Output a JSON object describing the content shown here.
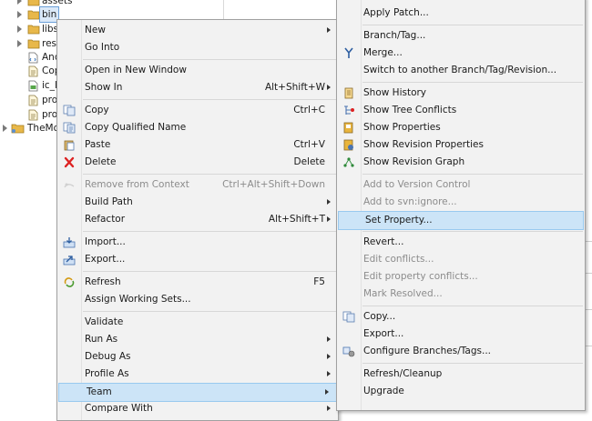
{
  "tree": {
    "items": [
      {
        "label": "assets",
        "icon": "folder-icon",
        "arrow": true
      },
      {
        "label": "bin",
        "icon": "folder-icon",
        "arrow": true,
        "selected": true
      },
      {
        "label": "libs",
        "icon": "folder-icon",
        "arrow": true
      },
      {
        "label": "res",
        "icon": "folder-icon",
        "arrow": true
      },
      {
        "label": "And",
        "icon": "xml-file-icon",
        "arrow": false
      },
      {
        "label": "Cop",
        "icon": "text-file-icon",
        "arrow": false
      },
      {
        "label": "ic_l",
        "icon": "image-file-icon",
        "arrow": false
      },
      {
        "label": "pro",
        "icon": "text-file-icon",
        "arrow": false
      },
      {
        "label": "pro",
        "icon": "text-file-icon",
        "arrow": false
      },
      {
        "label": "TheMo",
        "icon": "project-icon",
        "arrow": true
      }
    ]
  },
  "context_menu": {
    "items": [
      {
        "type": "item",
        "label": "New",
        "submenu": true
      },
      {
        "type": "item",
        "label": "Go Into"
      },
      {
        "type": "sep"
      },
      {
        "type": "item",
        "label": "Open in New Window"
      },
      {
        "type": "item",
        "label": "Show In",
        "shortcut": "Alt+Shift+W",
        "submenu": true
      },
      {
        "type": "sep"
      },
      {
        "type": "item",
        "label": "Copy",
        "shortcut": "Ctrl+C",
        "icon": "copy-icon"
      },
      {
        "type": "item",
        "label": "Copy Qualified Name",
        "icon": "copy-qualified-name-icon"
      },
      {
        "type": "item",
        "label": "Paste",
        "shortcut": "Ctrl+V",
        "icon": "paste-icon"
      },
      {
        "type": "item",
        "label": "Delete",
        "shortcut": "Delete",
        "icon": "delete-icon"
      },
      {
        "type": "sep"
      },
      {
        "type": "item",
        "label": "Remove from Context",
        "shortcut": "Ctrl+Alt+Shift+Down",
        "icon": "remove-context-icon",
        "disabled": true
      },
      {
        "type": "item",
        "label": "Build Path",
        "submenu": true
      },
      {
        "type": "item",
        "label": "Refactor",
        "shortcut": "Alt+Shift+T",
        "submenu": true
      },
      {
        "type": "sep"
      },
      {
        "type": "item",
        "label": "Import...",
        "icon": "import-icon"
      },
      {
        "type": "item",
        "label": "Export...",
        "icon": "export-icon"
      },
      {
        "type": "sep"
      },
      {
        "type": "item",
        "label": "Refresh",
        "shortcut": "F5",
        "icon": "refresh-icon"
      },
      {
        "type": "item",
        "label": "Assign Working Sets..."
      },
      {
        "type": "sep"
      },
      {
        "type": "item",
        "label": "Validate"
      },
      {
        "type": "item",
        "label": "Run As",
        "submenu": true
      },
      {
        "type": "item",
        "label": "Debug As",
        "submenu": true
      },
      {
        "type": "item",
        "label": "Profile As",
        "submenu": true
      },
      {
        "type": "item",
        "label": "Team",
        "submenu": true,
        "selected": true
      },
      {
        "type": "item",
        "label": "Compare With",
        "submenu": true
      }
    ]
  },
  "team_menu": {
    "items": [
      {
        "type": "item",
        "label": "Apply Patch..."
      },
      {
        "type": "sep"
      },
      {
        "type": "item",
        "label": "Branch/Tag..."
      },
      {
        "type": "item",
        "label": "Merge...",
        "icon": "merge-icon"
      },
      {
        "type": "item",
        "label": "Switch to another Branch/Tag/Revision..."
      },
      {
        "type": "sep"
      },
      {
        "type": "item",
        "label": "Show History",
        "icon": "history-icon"
      },
      {
        "type": "item",
        "label": "Show Tree Conflicts",
        "icon": "tree-conflicts-icon"
      },
      {
        "type": "item",
        "label": "Show Properties",
        "icon": "properties-icon"
      },
      {
        "type": "item",
        "label": "Show Revision Properties",
        "icon": "revision-properties-icon"
      },
      {
        "type": "item",
        "label": "Show Revision Graph",
        "icon": "revision-graph-icon"
      },
      {
        "type": "sep"
      },
      {
        "type": "item",
        "label": "Add to Version Control",
        "disabled": true
      },
      {
        "type": "item",
        "label": "Add to svn:ignore...",
        "disabled": true
      },
      {
        "type": "item",
        "label": "Set Property...",
        "selected": true
      },
      {
        "type": "sep"
      },
      {
        "type": "item",
        "label": "Revert..."
      },
      {
        "type": "item",
        "label": "Edit conflicts...",
        "disabled": true
      },
      {
        "type": "item",
        "label": "Edit property conflicts...",
        "disabled": true
      },
      {
        "type": "item",
        "label": "Mark Resolved...",
        "disabled": true
      },
      {
        "type": "sep"
      },
      {
        "type": "item",
        "label": "Copy...",
        "icon": "copy-icon"
      },
      {
        "type": "item",
        "label": "Export..."
      },
      {
        "type": "item",
        "label": "Configure Branches/Tags...",
        "icon": "configure-branches-icon"
      },
      {
        "type": "sep"
      },
      {
        "type": "item",
        "label": "Refresh/Cleanup"
      },
      {
        "type": "item",
        "label": "Upgrade"
      }
    ]
  },
  "colors": {
    "menu_bg": "#f2f2f2",
    "selection_bg": "#cce4f7",
    "selection_border": "#99c9ef",
    "disabled_text": "#8c8c8c"
  }
}
